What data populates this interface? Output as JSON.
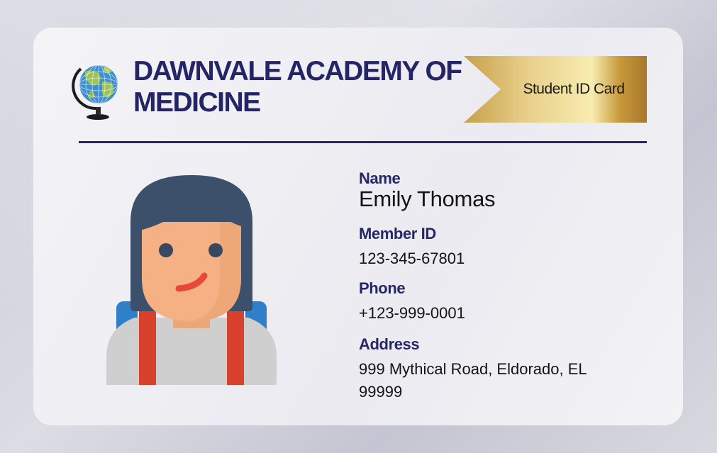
{
  "card": {
    "school_name": "DAWNVALE ACADEMY OF MEDICINE",
    "ribbon_label": "Student ID Card",
    "icons": {
      "logo": "globe-icon",
      "photo": "student-avatar-icon"
    }
  },
  "colors": {
    "primary_navy": "#262766",
    "gold": "#d9b65b",
    "card_bg": "#f4f4f7"
  },
  "fields": {
    "name_label": "Name",
    "name_value": "Emily Thomas",
    "member_id_label": "Member ID",
    "member_id_value": "123-345-67801",
    "phone_label": "Phone",
    "phone_value": "+123-999-0001",
    "address_label": "Address",
    "address_value": "999 Mythical Road, Eldorado, EL 99999"
  }
}
